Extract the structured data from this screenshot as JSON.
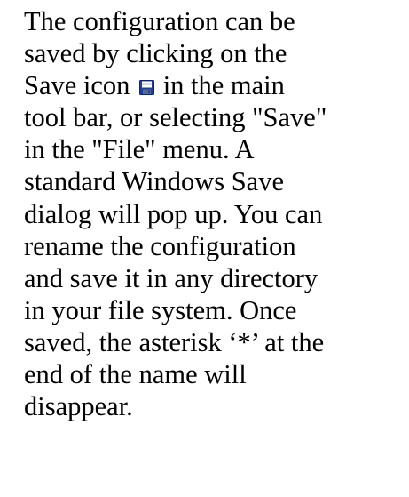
{
  "paragraph": {
    "lines": [
      {
        "text": "The configuration can be"
      },
      {
        "text": "saved by clicking on the"
      },
      {
        "before_icon": "Save icon ",
        "after_icon": " in the main"
      },
      {
        "text": "tool bar, or selecting \"Save\""
      },
      {
        "text": "in the \"File\" menu. A"
      },
      {
        "text": "standard Windows Save"
      },
      {
        "text": "dialog will pop up. You can"
      },
      {
        "text": "rename the configuration"
      },
      {
        "text": "and save it in any directory"
      },
      {
        "text": "in your file system. Once"
      },
      {
        "text": "saved, the asterisk ‘*’ at the"
      },
      {
        "text": "end of the name will"
      },
      {
        "text": "disappear."
      }
    ]
  },
  "icons": {
    "save_icon": "floppy-disk-save-icon"
  },
  "colors": {
    "text": "#000000",
    "background": "#ffffff",
    "icon_body": "#1f3f9a",
    "icon_label": "#ffffff",
    "icon_shutter": "#5a6a8a"
  }
}
